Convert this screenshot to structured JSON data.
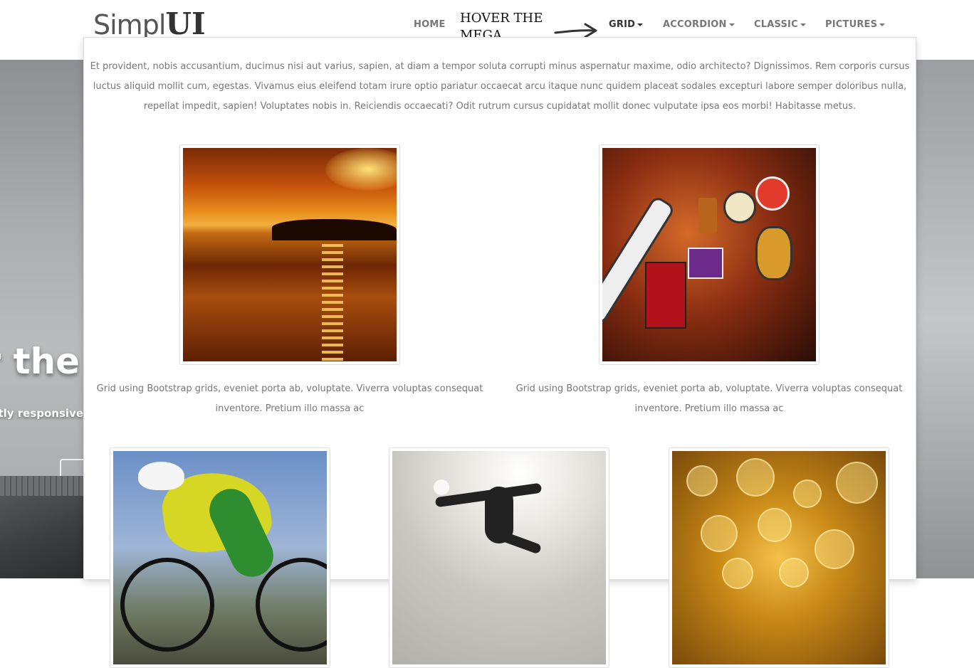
{
  "brand": {
    "light": "Simpl",
    "bold": "UI"
  },
  "nav": {
    "home": "HOME",
    "grid": "GRID",
    "accordion": "ACCORDION",
    "classic": "CLASSIC",
    "pictures": "PICTURES"
  },
  "hover_note": "HOVER THE MEGA MENUS",
  "hero": {
    "title_fragment": "r the",
    "subtitle_fragment": "ctly responsive"
  },
  "mega_menu": {
    "intro": "Et provident, nobis accusantium, ducimus nisi aut varius, sapien, at diam a tempor soluta corrupti minus aspernatur maxime, odio architecto? Dignissimos. Rem corporis cursus luctus aliquid mollit cum, egestas. Vivamus eius eleifend totam irure optio pariatur occaecat arcu itaque nunc quidem placeat sodales excepturi labore semper doloribus nulla, repellat impedit, sapien! Voluptates nobis in. Reiciendis occaecati? Odit rutrum cursus cupidatat mollit donec vulputate ipsa eos morbi! Habitasse metus.",
    "captions": [
      "Grid using Bootstrap grids, eveniet porta ab, voluptate. Viverra voluptas consequat inventore. Pretium illo massa ac",
      "Grid using Bootstrap grids, eveniet porta ab, voluptate. Viverra voluptas consequat inventore. Pretium illo massa ac"
    ],
    "images": [
      "sunset-photo",
      "bar-wall-photo",
      "cyclist-photo",
      "jump-kick-photo",
      "bokeh-lights-photo"
    ]
  },
  "colors": {
    "nav_text": "#777777",
    "nav_active": "#333333",
    "body_text": "#777777",
    "panel_border": "#dddddd"
  }
}
